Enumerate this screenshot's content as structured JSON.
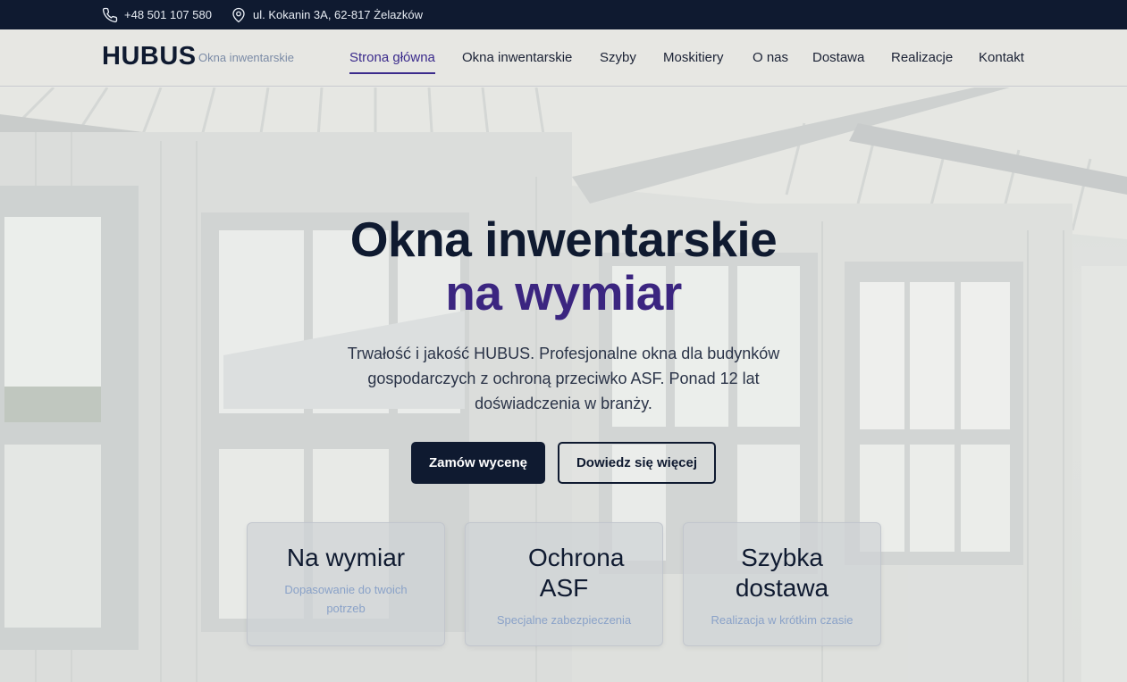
{
  "topbar": {
    "phone": "+48 501 107 580",
    "address": "ul. Kokanin 3A, 62-817 Żelazków",
    "phone_icon": "phone-icon",
    "address_icon": "map-pin-icon"
  },
  "nav": {
    "brand": "HUBUS",
    "brand_tagline": "Okna inwentarskie",
    "items": [
      {
        "label": "Strona główna",
        "active": true
      },
      {
        "label": "Okna inwentarskie"
      },
      {
        "label": "Szyby"
      },
      {
        "label": "Moskitiery"
      },
      {
        "label": "O nas"
      },
      {
        "label": "Dostawa"
      },
      {
        "label": "Realizacje"
      },
      {
        "label": "Kontakt"
      }
    ]
  },
  "hero": {
    "title_line1": "Okna inwentarskie",
    "title_line2": "na wymiar",
    "lead": "Trwałość i jakość HUBUS. Profesjonalne okna dla budynków gospodarczych z ochroną przeciwko ASF. Ponad 12 lat doświadczenia w branży.",
    "primary_button": "Zamów wycenę",
    "secondary_button": "Dowiedz się więcej",
    "features": [
      {
        "title": "Na wymiar",
        "subtitle": "Dopasowanie do twoich potrzeb"
      },
      {
        "title": "Ochrona ASF",
        "subtitle": "Specjalne zabezpieczenia"
      },
      {
        "title": "Szybka dostawa",
        "subtitle": "Realizacja w krótkim czasie"
      }
    ]
  },
  "colors": {
    "navy": "#0f1a30",
    "accent": "#3b2580",
    "muted_blue": "#8aa2c8"
  }
}
